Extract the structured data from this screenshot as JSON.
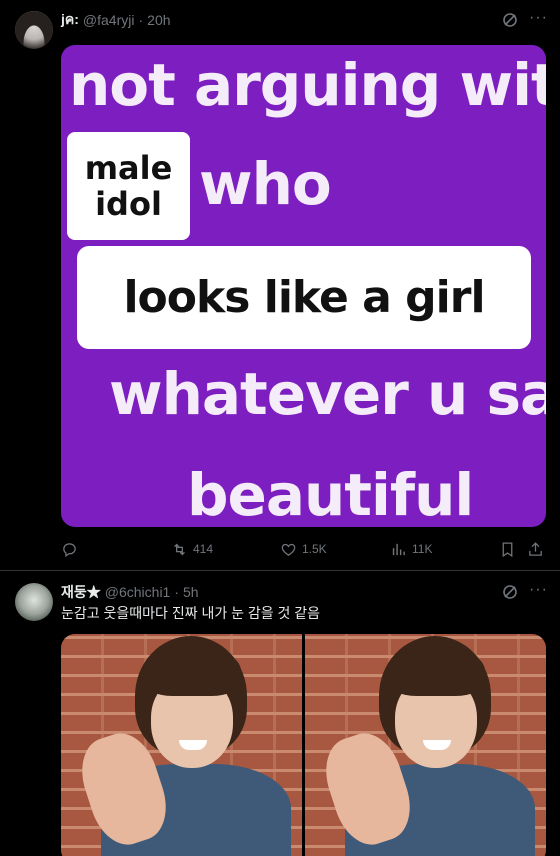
{
  "tweets": [
    {
      "name": "jค:",
      "handle": "@fa4ryji",
      "separator": "·",
      "time": "20h",
      "meme": {
        "line1": "not arguing with a",
        "box1_line1": "male",
        "box1_line2": "idol",
        "line2": "who",
        "box2": "looks like a girl",
        "line3": "whatever u say",
        "line4": "beautiful"
      },
      "actions": {
        "reply": "",
        "retweets": "414",
        "likes": "1.5K",
        "views": "11K"
      }
    },
    {
      "name": "재둥★",
      "handle": "@6chichi1",
      "separator": "·",
      "time": "5h",
      "text": "눈감고 웃을때마다 진짜 내가 눈 감을 것 같음"
    }
  ],
  "icons": {
    "grok": "grok-icon",
    "more": "more-icon",
    "reply": "reply-icon",
    "retweet": "retweet-icon",
    "like": "heart-icon",
    "views": "views-icon",
    "bookmark": "bookmark-icon",
    "share": "share-icon"
  },
  "colors": {
    "background": "#000000",
    "text": "#e7e9ea",
    "muted": "#71767b",
    "meme_purple": "#7d1ec0"
  }
}
